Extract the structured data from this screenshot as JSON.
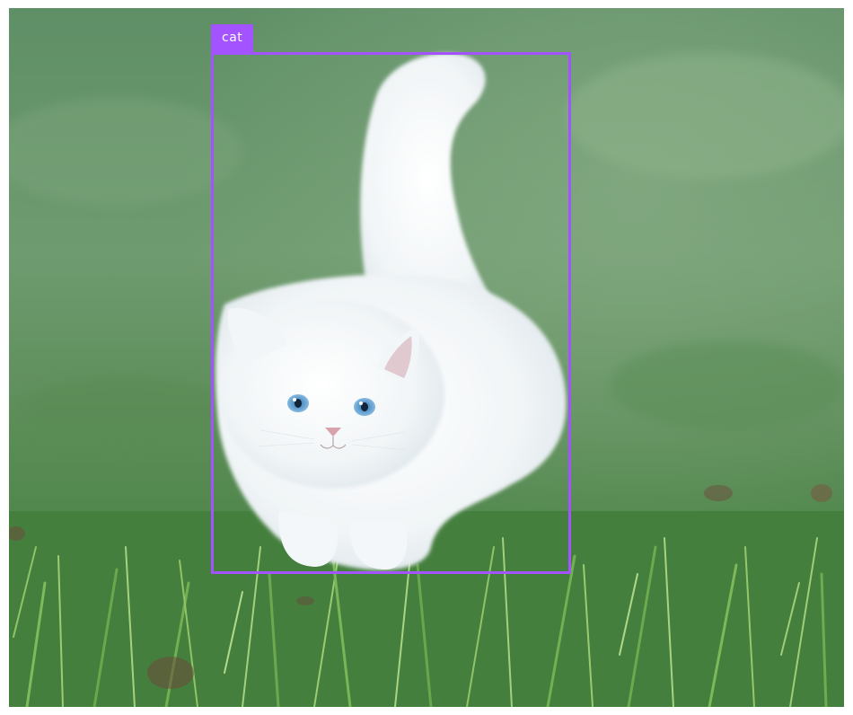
{
  "image": {
    "subject": "white-kitten-on-grass"
  },
  "detections": [
    {
      "label": "cat",
      "color": "#a353ff"
    }
  ],
  "colors": {
    "box": "#a353ff",
    "label_text": "#ffffff",
    "grass_dark": "#3f7a3a",
    "grass_light": "#8cc46a",
    "background_blur": "#6f9d72"
  }
}
